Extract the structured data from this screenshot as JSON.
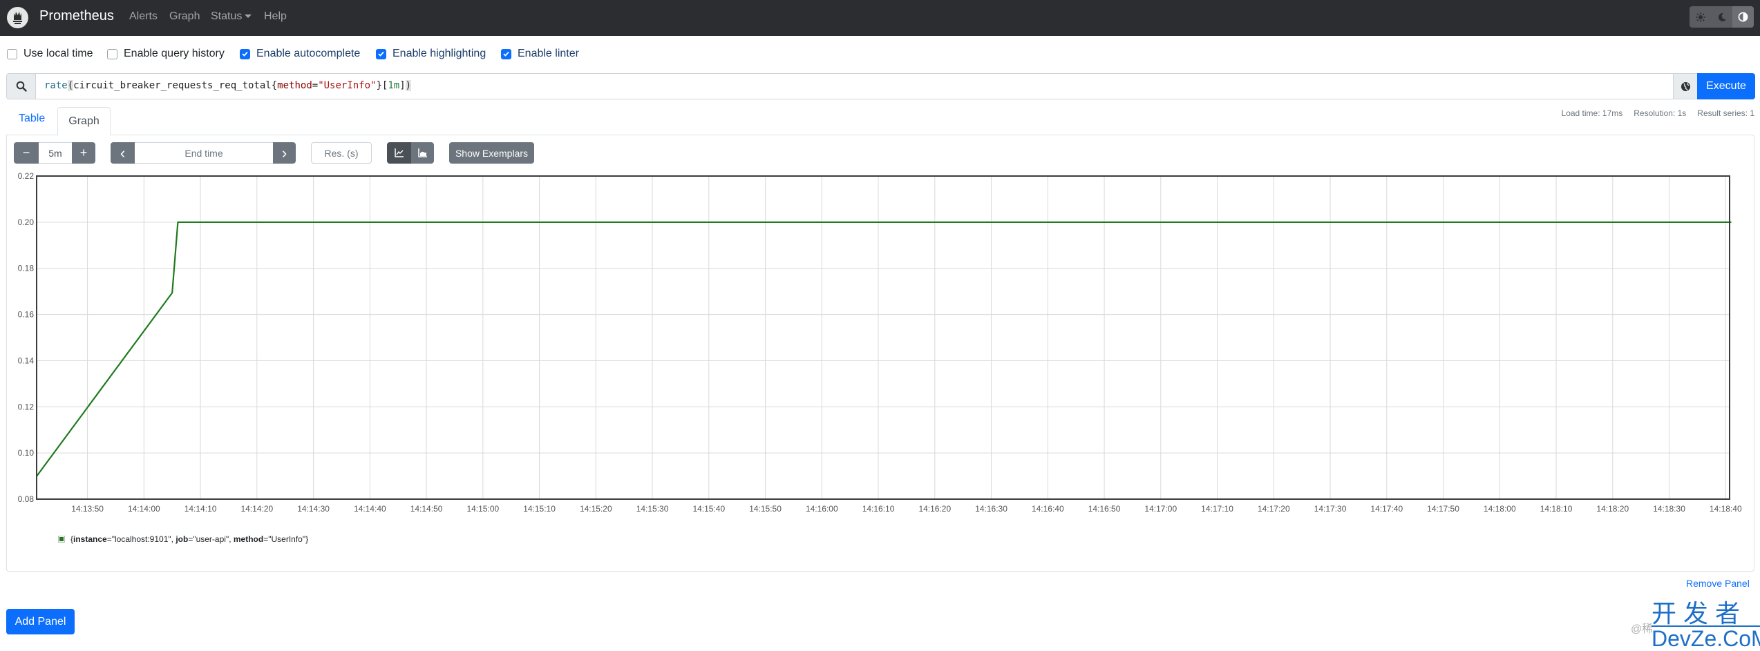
{
  "navbar": {
    "brand": "Prometheus",
    "links": [
      {
        "label": "Alerts"
      },
      {
        "label": "Graph"
      },
      {
        "label": "Status",
        "dropdown": true
      },
      {
        "label": "Help"
      }
    ],
    "theme_buttons": [
      {
        "icon": "sun-icon",
        "label": "light"
      },
      {
        "icon": "moon-icon",
        "label": "dark"
      },
      {
        "icon": "contrast-icon",
        "label": "browser default",
        "active": true
      }
    ]
  },
  "options": [
    {
      "label": "Use local time",
      "checked": false
    },
    {
      "label": "Enable query history",
      "checked": false
    },
    {
      "label": "Enable autocomplete",
      "checked": true
    },
    {
      "label": "Enable highlighting",
      "checked": true
    },
    {
      "label": "Enable linter",
      "checked": true
    }
  ],
  "query": {
    "expression": "rate(circuit_breaker_requests_req_total{method=\"UserInfo\"}[1m])",
    "tokens": {
      "fn": "rate",
      "open": "(",
      "metric": "circuit_breaker_requests_req_total",
      "brace_open": "{",
      "label_name": "method",
      "eq": "=",
      "label_value": "\"UserInfo\"",
      "brace_close": "}",
      "bracket_open": "[",
      "duration": "1m",
      "bracket_close": "]",
      "close": ")"
    },
    "execute_label": "Execute"
  },
  "tabs": [
    {
      "label": "Table",
      "active": false
    },
    {
      "label": "Graph",
      "active": true
    }
  ],
  "stats": {
    "load_time": "Load time: 17ms",
    "resolution": "Resolution: 1s",
    "result_series": "Result series: 1"
  },
  "controls": {
    "minus": "−",
    "range": "5m",
    "plus": "+",
    "prev": "‹",
    "end_time_placeholder": "End time",
    "next": "›",
    "resolution_placeholder": "Res. (s)",
    "show_exemplars": "Show Exemplars"
  },
  "chart_data": {
    "type": "line",
    "title": "",
    "xlabel": "",
    "ylabel": "",
    "ylim": [
      0.08,
      0.22
    ],
    "xlim": [
      "14:13:41",
      "14:18:41"
    ],
    "y_ticks": [
      "0.08",
      "0.10",
      "0.12",
      "0.14",
      "0.16",
      "0.18",
      "0.20",
      "0.22"
    ],
    "x_ticks": [
      "14:13:50",
      "14:14:00",
      "14:14:10",
      "14:14:20",
      "14:14:30",
      "14:14:40",
      "14:14:50",
      "14:15:00",
      "14:15:10",
      "14:15:20",
      "14:15:30",
      "14:15:40",
      "14:15:50",
      "14:16:00",
      "14:16:10",
      "14:16:20",
      "14:16:30",
      "14:16:40",
      "14:16:50",
      "14:17:00",
      "14:17:10",
      "14:17:20",
      "14:17:30",
      "14:17:40",
      "14:17:50",
      "14:18:00",
      "14:18:10",
      "14:18:20",
      "14:18:30",
      "14:18:40"
    ],
    "grid": true,
    "legend_position": "bottom-left",
    "series": [
      {
        "name": "{instance=\"localhost:9101\", job=\"user-api\", method=\"UserInfo\"}",
        "color": "#1e7b1e",
        "points": [
          {
            "t": "14:13:41",
            "v": 0.0899
          },
          {
            "t": "14:14:05",
            "v": 0.1694
          },
          {
            "t": "14:14:06",
            "v": 0.2
          },
          {
            "t": "14:18:41",
            "v": 0.2
          }
        ]
      }
    ]
  },
  "legend": {
    "labels": [
      {
        "key": "instance",
        "value": "\"localhost:9101\""
      },
      {
        "key": "job",
        "value": "\"user-api\""
      },
      {
        "key": "method",
        "value": "\"UserInfo\""
      }
    ]
  },
  "panel": {
    "remove_label": "Remove Panel",
    "add_label": "Add Panel"
  },
  "watermark": {
    "prefix": "@稀",
    "cn": "开发者",
    "en": "DevZe.CoM"
  }
}
